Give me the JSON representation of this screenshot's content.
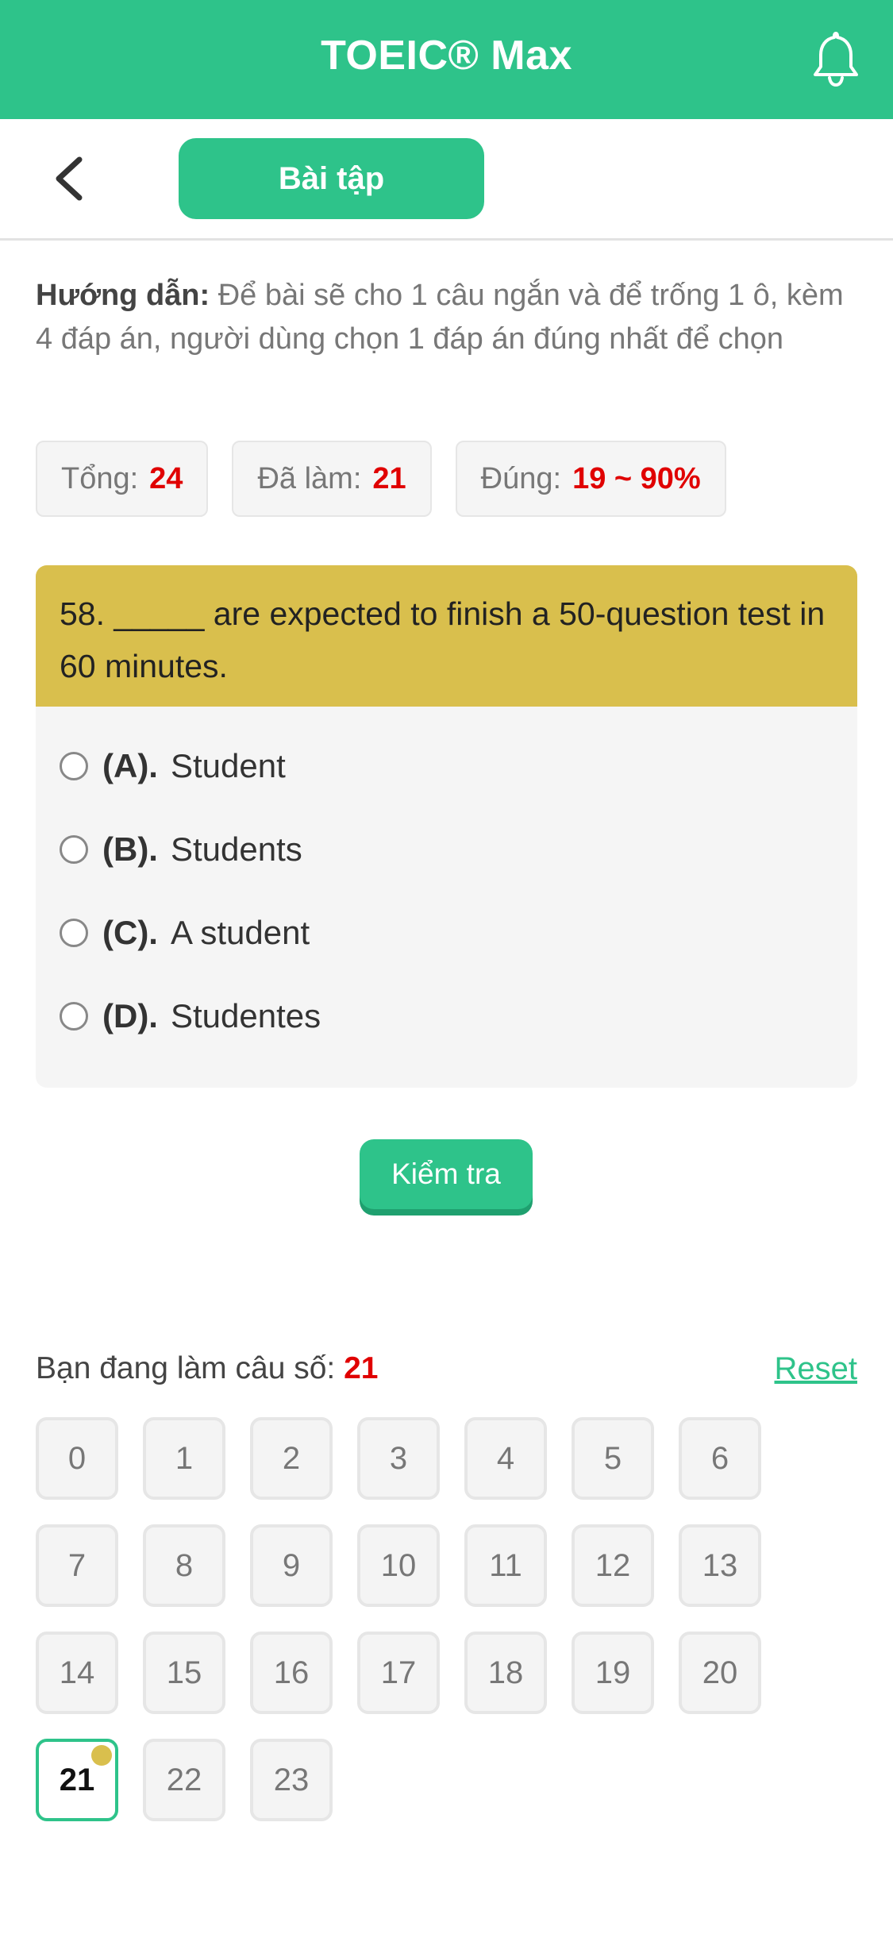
{
  "header": {
    "title": "TOEIC® Max",
    "bell_icon": "bell-icon"
  },
  "subheader": {
    "back_icon": "chevron-left-icon",
    "tab_label": "Bài tập"
  },
  "instructions": {
    "label": "Hướng dẫn:",
    "text": "Để bài sẽ cho 1 câu ngắn và để trống 1 ô, kèm 4 đáp án, người dùng chọn 1 đáp án đúng nhất để chọn"
  },
  "stats": {
    "total_label": "Tổng:",
    "total_value": "24",
    "done_label": "Đã làm:",
    "done_value": "21",
    "correct_label": "Đúng:",
    "correct_value": "19 ~ 90%"
  },
  "question": {
    "text": "58. _____ are expected to finish a 50-question test in 60 minutes.",
    "options": [
      {
        "letter": "(A).",
        "text": "Student"
      },
      {
        "letter": "(B).",
        "text": "Students"
      },
      {
        "letter": "(C).",
        "text": "A student"
      },
      {
        "letter": "(D).",
        "text": "Studentes"
      }
    ]
  },
  "check_button": "Kiểm tra",
  "progress": {
    "label": "Bạn đang làm câu số:",
    "current": "21",
    "reset": "Reset",
    "numbers": [
      "0",
      "1",
      "2",
      "3",
      "4",
      "5",
      "6",
      "7",
      "8",
      "9",
      "10",
      "11",
      "12",
      "13",
      "14",
      "15",
      "16",
      "17",
      "18",
      "19",
      "20",
      "21",
      "22",
      "23"
    ]
  },
  "colors": {
    "accent": "#2ec38a",
    "question_bg": "#d9bf4d",
    "highlight": "#e00000"
  }
}
